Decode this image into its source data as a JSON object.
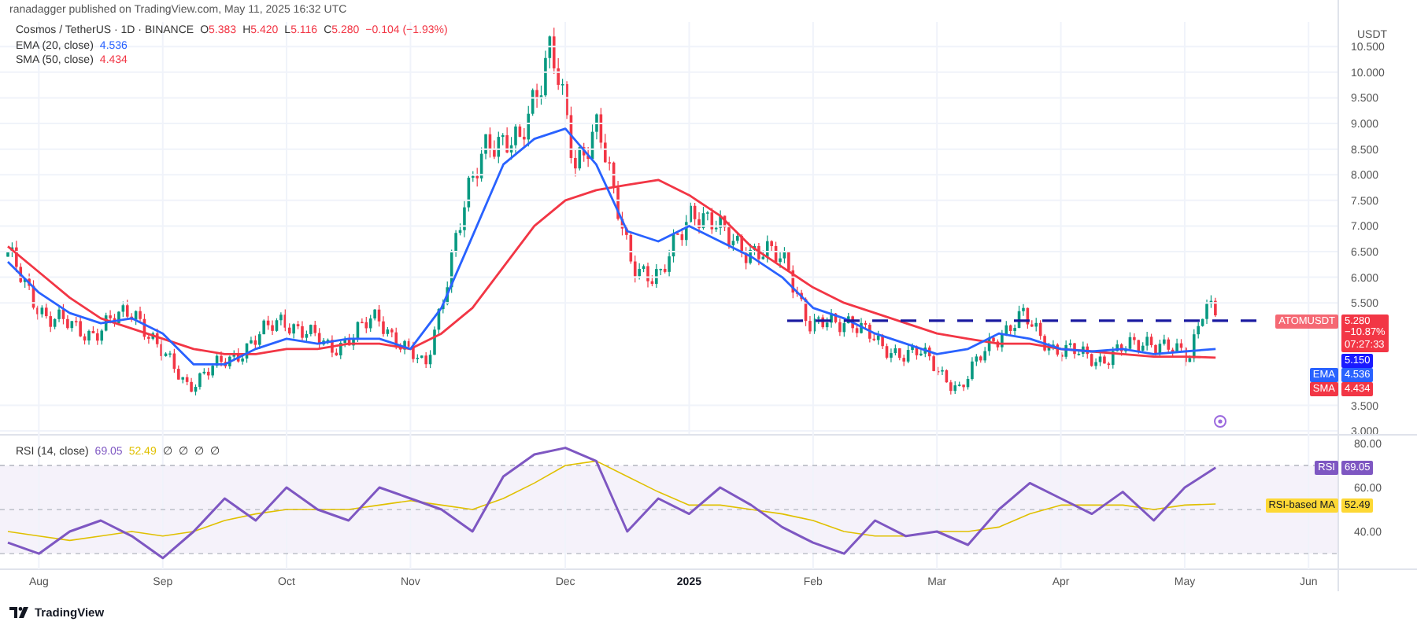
{
  "attribution": "ranadagger published on TradingView.com, May 11, 2025 16:32 UTC",
  "legend": {
    "symbol": "Cosmos / TetherUS · 1D · BINANCE",
    "ohlc": [
      {
        "label": "O",
        "value": "5.383"
      },
      {
        "label": "H",
        "value": "5.420"
      },
      {
        "label": "L",
        "value": "5.116"
      },
      {
        "label": "C",
        "value": "5.280"
      }
    ],
    "change": "−0.104 (−1.93%)",
    "indicator_values": [
      "4.536",
      "4.434"
    ]
  },
  "price_chart": {
    "unit": "USDT",
    "chart_data": {
      "type": "line",
      "grid": true,
      "ylim": [
        2.94,
        10.98
      ],
      "yticks": [
        {
          "value": 3,
          "label": "3.000"
        },
        {
          "value": 3.5,
          "label": "3.500"
        },
        {
          "value": 5.5,
          "label": "5.500"
        },
        {
          "value": 6,
          "label": "6.000"
        },
        {
          "value": 6.5,
          "label": "6.500"
        },
        {
          "value": 7,
          "label": "7.000"
        },
        {
          "value": 7.5,
          "label": "7.500"
        },
        {
          "value": 8,
          "label": "8.000"
        },
        {
          "value": 8.5,
          "label": "8.500"
        },
        {
          "value": 9,
          "label": "9.000"
        },
        {
          "value": 9.5,
          "label": "9.500"
        },
        {
          "value": 10,
          "label": "10.000"
        },
        {
          "value": 10.5,
          "label": "10.500"
        }
      ],
      "series": [
        {
          "name": "EMA (20, close)",
          "color": "#2962ff",
          "values": [
            6.3,
            5.7,
            5.3,
            5.1,
            5.2,
            4.9,
            4.3,
            4.3,
            4.6,
            4.8,
            4.7,
            4.8,
            4.8,
            4.6,
            5.4,
            6.8,
            8.2,
            8.7,
            8.9,
            8.2,
            6.9,
            6.7,
            7.0,
            6.7,
            6.4,
            6.0,
            5.4,
            5.2,
            4.9,
            4.7,
            4.5,
            4.6,
            4.9,
            4.8,
            4.6,
            4.55,
            4.6,
            4.5,
            4.55,
            4.6,
            null,
            null,
            null
          ]
        },
        {
          "name": "SMA (50, close)",
          "color": "#f23645",
          "values": [
            6.6,
            6.1,
            5.6,
            5.2,
            5.0,
            4.8,
            4.6,
            4.5,
            4.5,
            4.6,
            4.6,
            4.7,
            4.7,
            4.6,
            4.9,
            5.4,
            6.2,
            7.0,
            7.5,
            7.7,
            7.8,
            7.9,
            7.6,
            7.2,
            6.6,
            6.2,
            5.8,
            5.5,
            5.3,
            5.1,
            4.9,
            4.8,
            4.7,
            4.7,
            4.6,
            4.55,
            4.5,
            4.45,
            4.45,
            4.43,
            null,
            null,
            null
          ]
        }
      ]
    }
  },
  "price_tags": [
    {
      "kind": "symbol",
      "label": "ATOMUSDT",
      "lines": [
        "5.280",
        "−10.87%",
        "07:27:33"
      ],
      "color": "#f23645"
    },
    {
      "kind": "line",
      "lines": [
        "5.150"
      ],
      "color": "#1a1aff"
    },
    {
      "kind": "indicator",
      "label": "EMA",
      "lines": [
        "4.536"
      ],
      "color": "#2962ff"
    },
    {
      "kind": "indicator",
      "label": "SMA",
      "lines": [
        "4.434"
      ],
      "color": "#f23645"
    }
  ],
  "rsi": {
    "title": "RSI (14, close)",
    "values": [
      "69.05",
      "52.49"
    ],
    "hidden": [
      "∅",
      "∅",
      "∅",
      "∅"
    ],
    "year_label": {
      "label": "2025",
      "bold": true
    },
    "chart_data": {
      "type": "line",
      "grid": true,
      "ylim": [
        22.9,
        84.3
      ],
      "categories": [
        null,
        "Aug",
        null,
        null,
        null,
        "Sep",
        null,
        null,
        null,
        "Oct",
        null,
        null,
        null,
        "Nov",
        null,
        null,
        null,
        null,
        "Dec",
        null,
        null,
        null,
        null,
        null,
        null,
        null,
        "Feb",
        null,
        null,
        null,
        "Mar",
        null,
        null,
        null,
        "Apr",
        null,
        null,
        null,
        "May",
        null,
        null,
        null,
        "Jun"
      ],
      "yticks": [
        {
          "value": 40,
          "label": "40.00"
        },
        {
          "value": 60,
          "label": "60.00"
        },
        {
          "value": 80,
          "label": "80.00"
        }
      ],
      "series": [
        {
          "name": "RSI",
          "color": "#7e57c2",
          "values": [
            35,
            30,
            40,
            45,
            38,
            28,
            40,
            55,
            45,
            60,
            50,
            45,
            60,
            55,
            50,
            40,
            65,
            75,
            78,
            72,
            40,
            55,
            48,
            60,
            52,
            42,
            35,
            30,
            45,
            38,
            40,
            34,
            50,
            62,
            55,
            48,
            58,
            45,
            60,
            69,
            null,
            null,
            null
          ]
        },
        {
          "name": "RSI-based MA",
          "color": "#e0c000",
          "values": [
            40,
            38,
            36,
            38,
            40,
            38,
            40,
            45,
            48,
            50,
            50,
            50,
            52,
            54,
            52,
            50,
            55,
            62,
            70,
            72,
            65,
            58,
            52,
            52,
            50,
            48,
            45,
            40,
            38,
            38,
            40,
            40,
            42,
            48,
            52,
            52,
            52,
            50,
            52,
            52.5,
            null,
            null,
            null
          ]
        }
      ]
    },
    "tags": [
      {
        "value": "69.05",
        "color": "#7e57c2"
      },
      {
        "value": "52.49",
        "color": "#fdd835"
      }
    ]
  },
  "footer": {
    "brand": "TradingView"
  }
}
